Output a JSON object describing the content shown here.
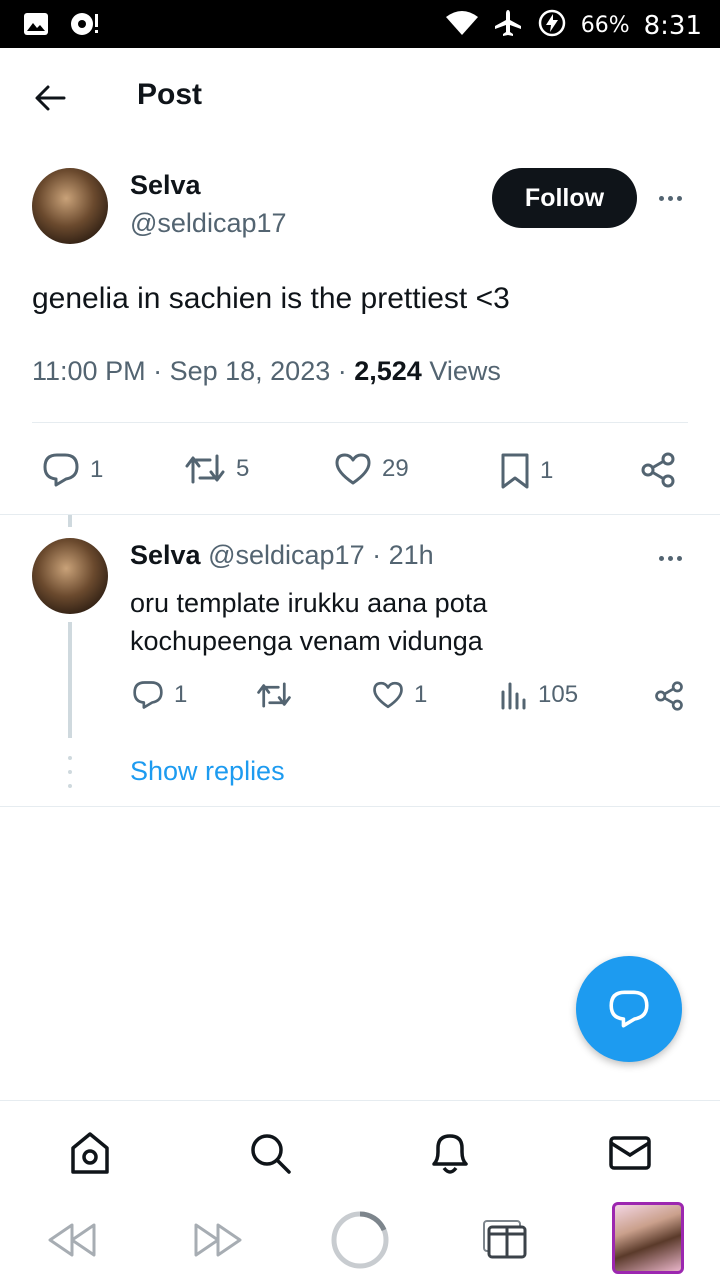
{
  "status_bar": {
    "battery": "66%",
    "time": "8:31"
  },
  "header": {
    "title": "Post"
  },
  "tweet": {
    "author_name": "Selva",
    "author_handle": "@seldicap17",
    "follow_label": "Follow",
    "text": "genelia in sachien is the prettiest <3",
    "time": "11:00 PM",
    "date": "Sep 18, 2023",
    "views_count": "2,524",
    "views_label": "Views",
    "replies": "1",
    "retweets": "5",
    "likes": "29",
    "bookmarks": "1"
  },
  "reply": {
    "author_name": "Selva",
    "author_handle": "@seldicap17",
    "age": "21h",
    "text": "oru template irukku aana pota kochupeenga venam vidunga",
    "replies": "1",
    "likes": "1",
    "views": "105",
    "show_replies_label": "Show replies"
  },
  "colors": {
    "accent": "#1d9bf0",
    "text": "#0f1419",
    "secondary": "#536471"
  }
}
